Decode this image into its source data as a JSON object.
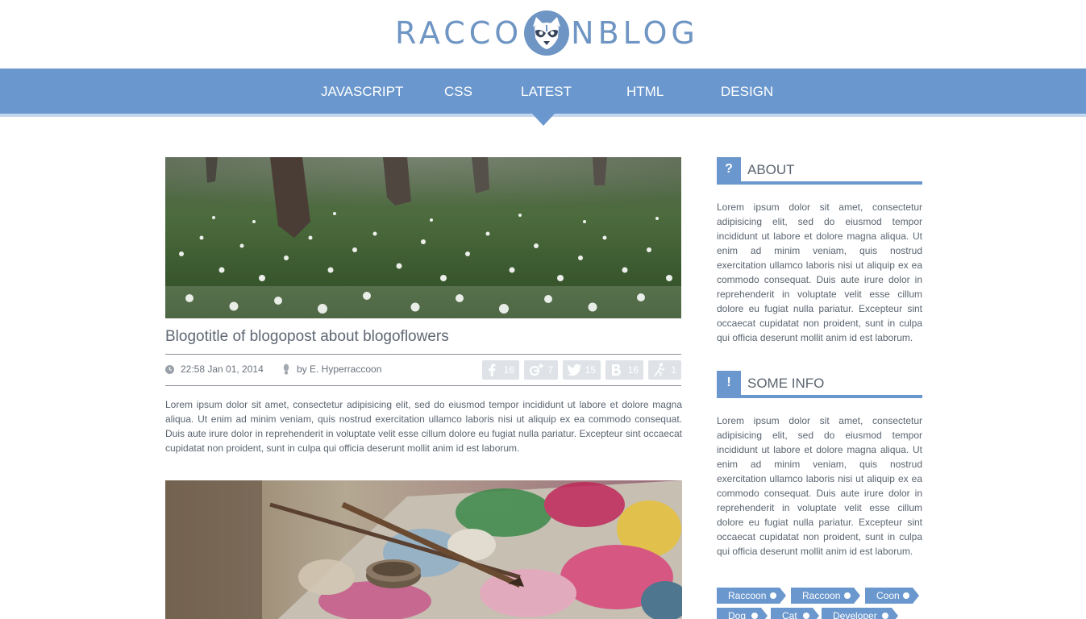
{
  "brand": {
    "logo_left": "RACCO",
    "logo_right": "NBLOG",
    "accent": "#6a97cd",
    "logo_color": "#6e95c3"
  },
  "nav": {
    "items": [
      "JAVASCRIPT",
      "CSS",
      "LATEST",
      "HTML",
      "DESIGN"
    ],
    "active": "LATEST"
  },
  "posts": [
    {
      "image": "snowdrop-flowers-photo",
      "title": "Blogotitle of blogopost about blogoflowers",
      "time": "22:58 Jan 01, 2014",
      "author": "by E. Hyperraccoon",
      "shares": [
        {
          "icon": "facebook-icon",
          "count": "16"
        },
        {
          "icon": "google-plus-icon",
          "count": "7"
        },
        {
          "icon": "twitter-icon",
          "count": "15"
        },
        {
          "icon": "vk-icon",
          "count": "16"
        },
        {
          "icon": "person-icon",
          "count": "1"
        }
      ],
      "body": "Lorem ipsum dolor sit amet, consectetur adipisicing elit, sed do eiusmod tempor incididunt ut labore et dolore magna aliqua. Ut enim ad minim veniam, quis nostrud exercitation ullamco laboris nisi ut aliquip ex ea commodo consequat. Duis aute irure dolor in reprehenderit in voluptate velit esse cillum dolore eu fugiat nulla pariatur. Excepteur sint occaecat cupidatat non proident, sunt in culpa qui officia deserunt mollit anim id est laborum."
    },
    {
      "image": "paint-palette-photo"
    }
  ],
  "sidebar": {
    "about": {
      "badge": "?",
      "title": "ABOUT",
      "text": "Lorem ipsum dolor sit amet, consectetur adipisicing elit, sed do eiusmod tempor incididunt ut labore et dolore magna aliqua. Ut enim ad minim veniam, quis nostrud exercitation ullamco laboris nisi ut aliquip ex ea commodo consequat. Duis aute irure dolor in reprehenderit in voluptate velit esse cillum dolore eu fugiat nulla pariatur. Excepteur sint occaecat cupidatat non proident, sunt in culpa qui officia deserunt mollit anim id est laborum."
    },
    "info": {
      "badge": "!",
      "title": "SOME INFO",
      "text": "Lorem ipsum dolor sit amet, consectetur adipisicing elit, sed do eiusmod tempor incididunt ut labore et dolore magna aliqua. Ut enim ad minim veniam, quis nostrud exercitation ullamco laboris nisi ut aliquip ex ea commodo consequat. Duis aute irure dolor in reprehenderit in voluptate velit esse cillum dolore eu fugiat nulla pariatur. Excepteur sint occaecat cupidatat non proident, sunt in culpa qui officia deserunt mollit anim id est laborum."
    },
    "tags": [
      "Raccoon",
      "Raccoon",
      "Coon",
      "Dog",
      "Cat",
      "Developer"
    ]
  }
}
